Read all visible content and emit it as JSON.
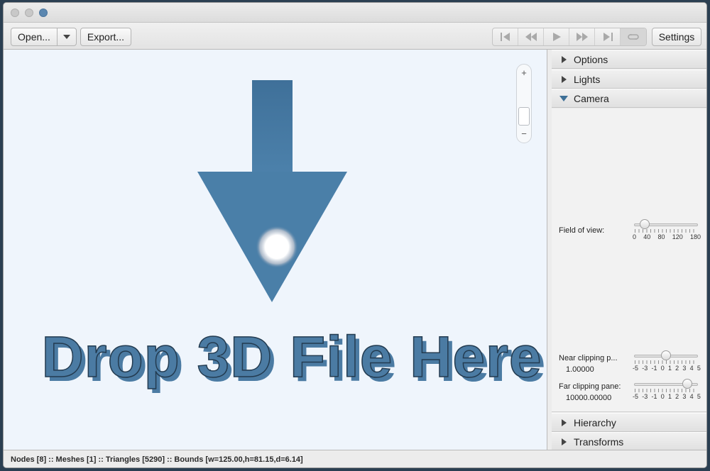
{
  "toolbar": {
    "open_label": "Open...",
    "export_label": "Export...",
    "settings_label": "Settings"
  },
  "viewport": {
    "drop_text": "Drop 3D File Here",
    "zoom_in": "+",
    "zoom_out": "−",
    "accent_color": "#4b7ba3"
  },
  "panel": {
    "options_label": "Options",
    "lights_label": "Lights",
    "camera_label": "Camera",
    "hierarchy_label": "Hierarchy",
    "transforms_label": "Transforms",
    "camera": {
      "fov_label": "Field of view:",
      "fov_ticks": [
        "0",
        "40",
        "80",
        "120",
        "180"
      ],
      "fov_value_fraction": 0.1,
      "near_label": "Near clipping p...",
      "near_value": "1.00000",
      "near_ticks": [
        "-5",
        "-3",
        "-1",
        "0",
        "1",
        "2",
        "3",
        "4",
        "5"
      ],
      "near_value_fraction": 0.5,
      "far_label": "Far clipping pane:",
      "far_value": "10000.00000",
      "far_ticks": [
        "-5",
        "-3",
        "-1",
        "0",
        "1",
        "2",
        "3",
        "4",
        "5"
      ],
      "far_value_fraction": 0.9
    }
  },
  "status": {
    "text": "Nodes [8] :: Meshes [1] :: Triangles [5290] :: Bounds [w=125.00,h=81.15,d=6.14]"
  }
}
